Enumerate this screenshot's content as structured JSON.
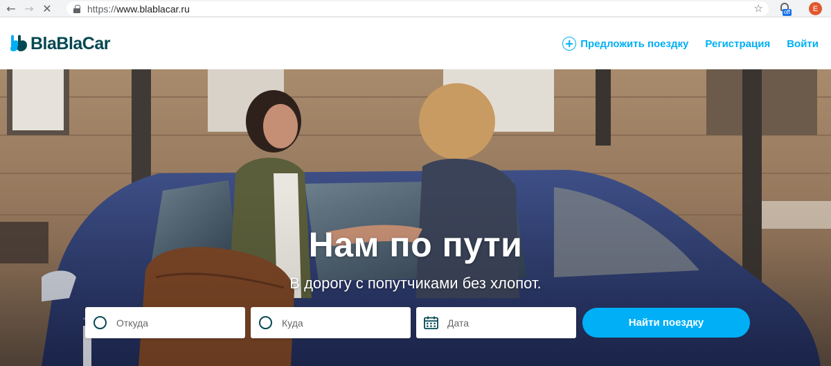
{
  "browser": {
    "url_scheme": "https://",
    "url_host": "www.blablacar.ru",
    "back_icon": "arrow-left-icon",
    "forward_icon": "arrow-right-icon",
    "stop_icon": "close-icon",
    "bookmark_icon": "star-icon",
    "extension_badge": "off",
    "profile_initial": "E"
  },
  "header": {
    "logo_text": "BlaBlaCar",
    "nav": {
      "offer_ride": "Предложить поездку",
      "register": "Регистрация",
      "login": "Войти"
    }
  },
  "hero": {
    "title": "Нам по пути",
    "subtitle": "В дорогу с попутчиками без хлопот."
  },
  "search": {
    "from_placeholder": "Откуда",
    "to_placeholder": "Куда",
    "date_placeholder": "Дата",
    "button_label": "Найти поездку"
  },
  "colors": {
    "brand_blue": "#00aff5",
    "brand_dark": "#054752"
  }
}
